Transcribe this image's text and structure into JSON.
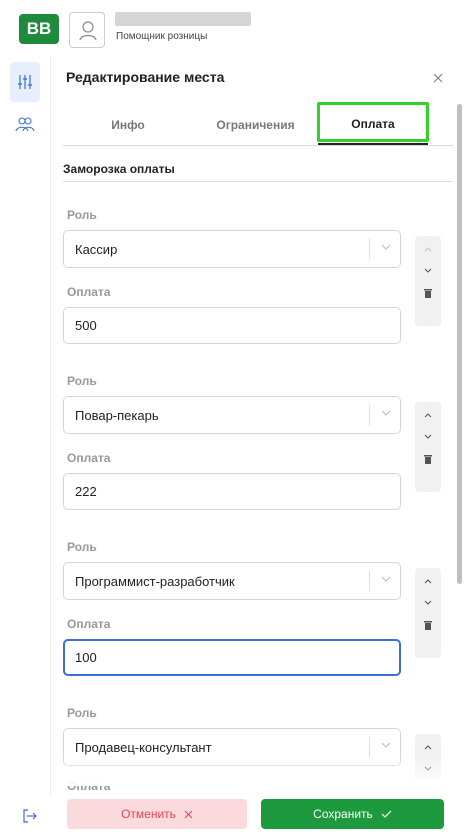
{
  "app": {
    "logo_text": "BB",
    "user_role": "Помощник розницы",
    "brand_color": "#1f8a3b"
  },
  "rail": {
    "items": [
      {
        "icon": "sliders-icon",
        "active": true
      },
      {
        "icon": "users-icon",
        "active": false
      }
    ],
    "bottom_icon": "logout-icon"
  },
  "panel": {
    "title": "Редактирование места",
    "close_icon": "close-icon",
    "tabs": [
      {
        "label": "Инфо",
        "active": false
      },
      {
        "label": "Ограничения",
        "active": false
      },
      {
        "label": "Оплата",
        "active": true
      }
    ],
    "section_title": "Заморозка оплаты",
    "groups": [
      {
        "role_label": "Роль",
        "role_value": "Кассир",
        "pay_label": "Оплата",
        "pay_value": "500"
      },
      {
        "role_label": "Роль",
        "role_value": "Повар-пекарь",
        "pay_label": "Оплата",
        "pay_value": "222"
      },
      {
        "role_label": "Роль",
        "role_value": "Программист-разработчик",
        "pay_label": "Оплата",
        "pay_value": "100"
      },
      {
        "role_label": "Роль",
        "role_value": "Продавец-консультант",
        "pay_label": "Оплата",
        "pay_value": ""
      }
    ]
  },
  "footer": {
    "cancel_label": "Отменить",
    "save_label": "Сохранить",
    "cancel_color": "#e0454f",
    "save_color": "#1e9a3e"
  }
}
